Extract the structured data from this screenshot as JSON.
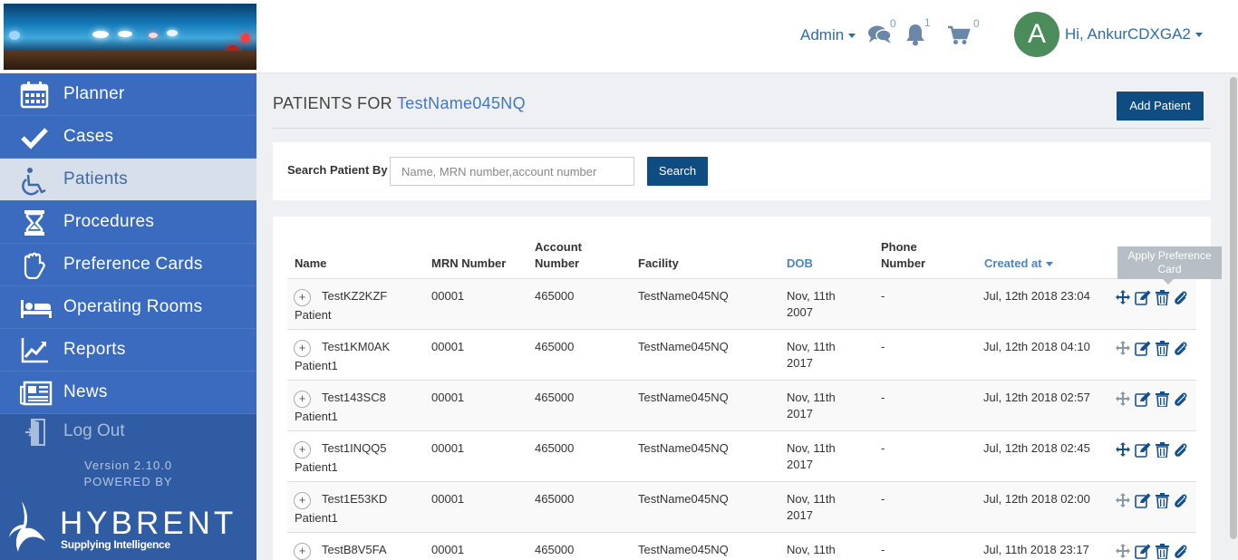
{
  "header": {
    "admin_label": "Admin",
    "messages_count": "0",
    "notifications_count": "1",
    "cart_count": "0",
    "avatar_initial": "A",
    "greeting": "Hi, AnkurCDXGA2"
  },
  "sidebar": {
    "items": [
      {
        "label": "Planner",
        "icon": "calendar-icon"
      },
      {
        "label": "Cases",
        "icon": "checkmark-icon"
      },
      {
        "label": "Patients",
        "icon": "wheelchair-icon"
      },
      {
        "label": "Procedures",
        "icon": "hourglass-icon"
      },
      {
        "label": "Preference Cards",
        "icon": "glove-icon"
      },
      {
        "label": "Operating Rooms",
        "icon": "bed-icon"
      },
      {
        "label": "Reports",
        "icon": "chart-icon"
      },
      {
        "label": "News",
        "icon": "newspaper-icon"
      }
    ],
    "logout_label": "Log Out",
    "version": "Version 2.10.0",
    "powered_by": "POWERED BY",
    "brand": "HYBRENT",
    "tagline": "Supplying Intelligence"
  },
  "page": {
    "title_prefix": "PATIENTS FOR",
    "facility": "TestName045NQ",
    "add_patient": "Add Patient"
  },
  "search": {
    "label": "Search Patient By",
    "placeholder": "Name, MRN number,account number",
    "button": "Search"
  },
  "table": {
    "headers": {
      "name": "Name",
      "mrn": "MRN Number",
      "account_1": "Account",
      "account_2": "Number",
      "facility": "Facility",
      "dob": "DOB",
      "phone_1": "Phone",
      "phone_2": "Number",
      "created": "Created at"
    },
    "rows": [
      {
        "first": "TestKZ2KZF",
        "last": "Patient",
        "mrn": "00001",
        "account": "465000",
        "facility": "TestName045NQ",
        "dob1": "Nov, 11th",
        "dob2": "2007",
        "phone": "-",
        "created": "Jul, 12th 2018 23:04"
      },
      {
        "first": "Test1KM0AK",
        "last": "Patient1",
        "mrn": "00001",
        "account": "465000",
        "facility": "TestName045NQ",
        "dob1": "Nov, 11th",
        "dob2": "2017",
        "phone": "-",
        "created": "Jul, 12th 2018 04:10"
      },
      {
        "first": "Test143SC8",
        "last": "Patient1",
        "mrn": "00001",
        "account": "465000",
        "facility": "TestName045NQ",
        "dob1": "Nov, 11th",
        "dob2": "2017",
        "phone": "-",
        "created": "Jul, 12th 2018 02:57"
      },
      {
        "first": "Test1INQQ5",
        "last": "Patient1",
        "mrn": "00001",
        "account": "465000",
        "facility": "TestName045NQ",
        "dob1": "Nov, 11th",
        "dob2": "2017",
        "phone": "-",
        "created": "Jul, 12th 2018 02:45"
      },
      {
        "first": "Test1E53KD",
        "last": "Patient1",
        "mrn": "00001",
        "account": "465000",
        "facility": "TestName045NQ",
        "dob1": "Nov, 11th",
        "dob2": "2017",
        "phone": "-",
        "created": "Jul, 12th 2018 02:00"
      },
      {
        "first": "TestB8V5FA",
        "last": "",
        "mrn": "00001",
        "account": "465000",
        "facility": "TestName045NQ",
        "dob1": "Nov, 11th",
        "dob2": "",
        "phone": "-",
        "created": "Jul, 11th 2018 23:17"
      }
    ],
    "tooltip": "Apply Preference Card"
  }
}
